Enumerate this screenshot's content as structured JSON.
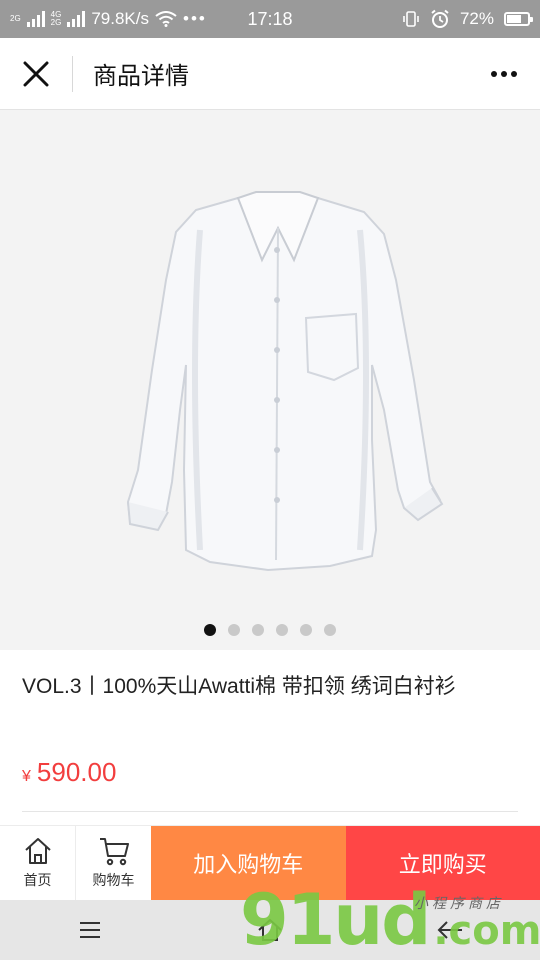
{
  "status_bar": {
    "net_speed": "79.8K/s",
    "network_tag_top": "4G",
    "network_tag_bottom": "2G",
    "sim_tag": "2G",
    "time": "17:18",
    "battery_percent": "72%",
    "battery_level": 0.72
  },
  "nav": {
    "title": "商品详情"
  },
  "gallery": {
    "image_count": 6,
    "active_index": 0
  },
  "product": {
    "title": "VOL.3丨100%天山Awatti棉 带扣领 绣词白衬衫",
    "currency": "¥",
    "price": "590.00"
  },
  "actions": {
    "home_label": "首页",
    "cart_label": "购物车",
    "add_to_cart_label": "加入购物车",
    "buy_now_label": "立即购买"
  },
  "watermark": {
    "brand": "91ud",
    "suffix": ".com",
    "tagline": "小程序商店"
  },
  "colors": {
    "status_bar_bg": "#9a9a9a",
    "price": "#f23e3e",
    "add_to_cart_bg": "#ff8844",
    "buy_now_bg": "#ff4646",
    "watermark": "#7ac943"
  }
}
